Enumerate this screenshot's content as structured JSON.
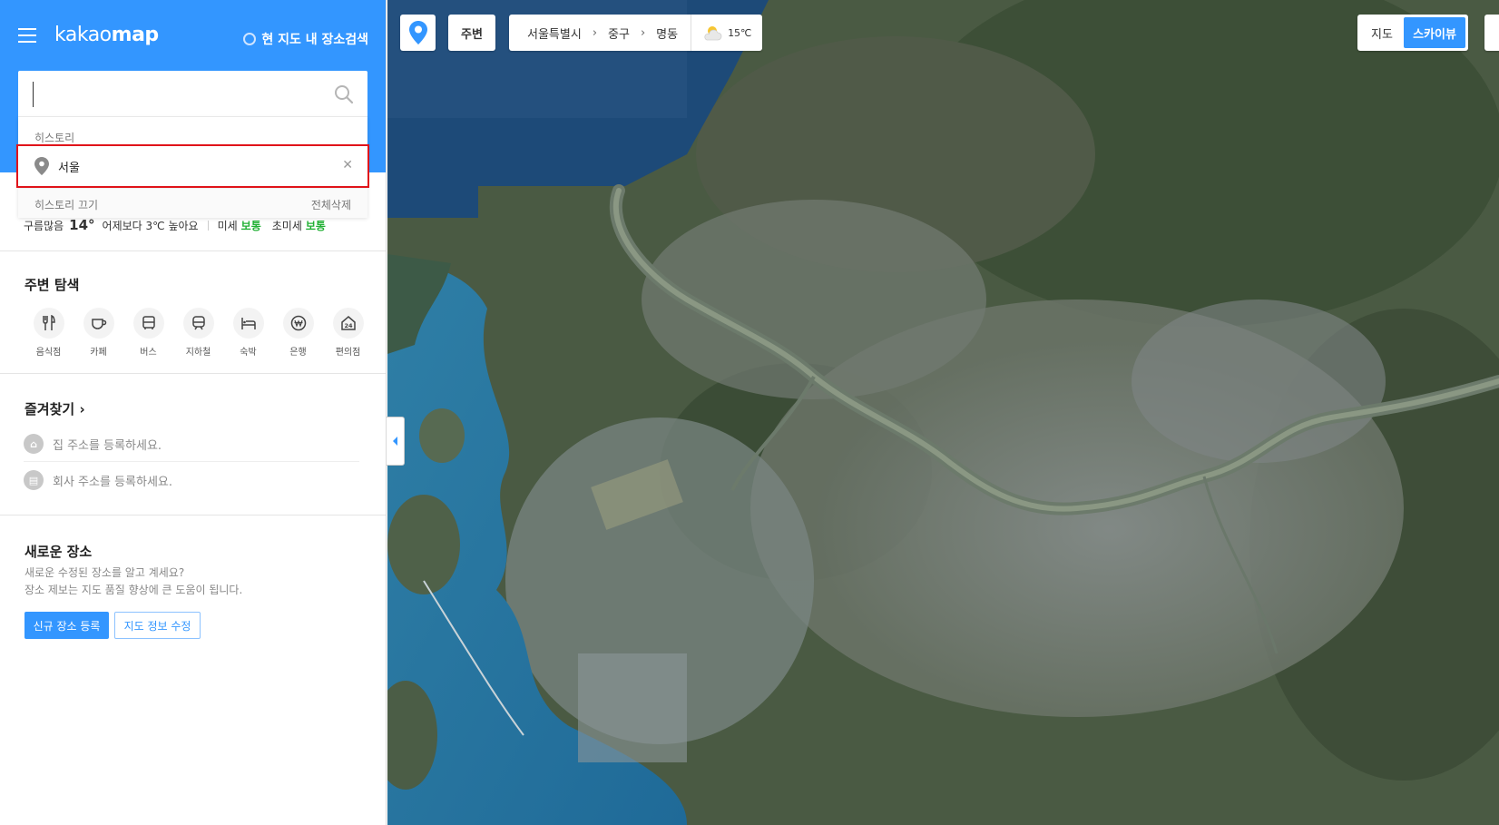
{
  "header": {
    "logo_prefix": "kakao",
    "logo_suffix": "map",
    "in_map_search_label": "현 지도 내 장소검색"
  },
  "search": {
    "value": "",
    "placeholder": ""
  },
  "history": {
    "label": "히스토리",
    "items": [
      {
        "text": "서울"
      }
    ],
    "turn_off_label": "히스토리 끄기",
    "delete_all_label": "전체삭제"
  },
  "weather": {
    "condition": "구름많음",
    "temperature": "14°",
    "compare": "어제보다 3℃ 높아요",
    "fine_dust_label": "미세",
    "fine_dust_value": "보통",
    "ultrafine_dust_label": "초미세",
    "ultrafine_dust_value": "보통"
  },
  "nearby": {
    "title": "주변 탐색",
    "categories": [
      {
        "label": "음식점",
        "icon": "restaurant-icon"
      },
      {
        "label": "카페",
        "icon": "cafe-icon"
      },
      {
        "label": "버스",
        "icon": "bus-icon"
      },
      {
        "label": "지하철",
        "icon": "subway-icon"
      },
      {
        "label": "숙박",
        "icon": "hotel-icon"
      },
      {
        "label": "은행",
        "icon": "bank-icon"
      },
      {
        "label": "편의점",
        "icon": "convenience-store-icon"
      }
    ]
  },
  "favorites": {
    "title": "즐겨찾기",
    "home_text": "집 주소를 등록하세요.",
    "work_text": "회사 주소를 등록하세요."
  },
  "new_place": {
    "title": "새로운 장소",
    "desc_line1": "새로운 수정된 장소를 알고 계세요?",
    "desc_line2": "장소 제보는 지도 품질 향상에 큰 도움이 됩니다.",
    "register_button": "신규 장소 등록",
    "edit_button": "지도 정보 수정"
  },
  "map_toolbar": {
    "around_label": "주변",
    "breadcrumb": [
      "서울특별시",
      "중구",
      "명동"
    ],
    "weather_temp": "15℃",
    "map_type_map": "지도",
    "map_type_skyview": "스카이뷰"
  },
  "colors": {
    "brand_blue": "#3396ff",
    "highlight_red": "#e0141a",
    "dust_good": "#21b034"
  }
}
